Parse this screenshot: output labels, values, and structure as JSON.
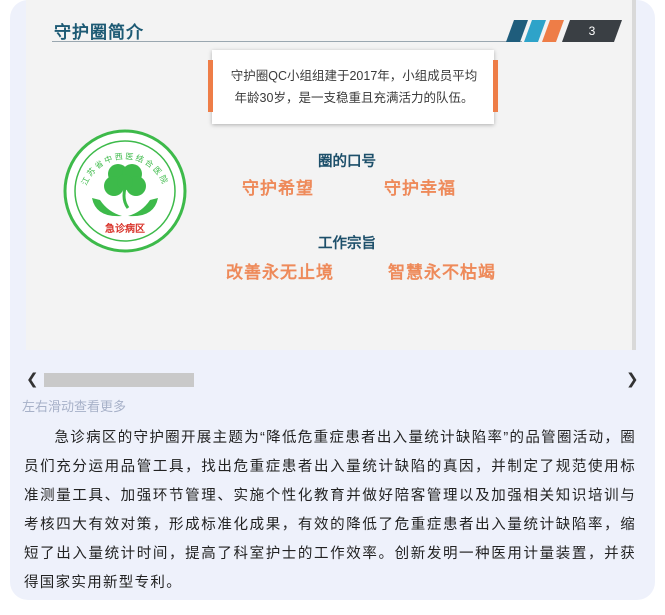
{
  "slide": {
    "title": "守护圈简介",
    "page_number": "3",
    "stripe_colors": [
      "#1f5d7c",
      "#2ea3c9",
      "#ee7d47"
    ],
    "intro": "守护圈QC小组组建于2017年，小组成员平均年龄30岁，是一支稳重且充满活力的队伍。",
    "slogan_heading": "圈的口号",
    "slogans": [
      "守护希望",
      "守护幸福"
    ],
    "purpose_heading": "工作宗旨",
    "purposes": [
      "改善永无止境",
      "智慧永不枯竭"
    ],
    "logo": {
      "ring_text": "江苏省中西医结合医院",
      "label": "急诊病区",
      "color": "#3dba4a"
    }
  },
  "scroll": {
    "left_icon": "chevron-left-icon",
    "right_icon": "chevron-right-icon"
  },
  "hint": "左右滑动查看更多",
  "paragraph": "急诊病区的守护圈开展主题为“降低危重症患者出入量统计缺陷率”的品管圈活动，圈员们充分运用品管工具，找出危重症患者出入量统计缺陷的真因，并制定了规范使用标准测量工具、加强环节管理、实施个性化教育并做好陪客管理以及加强相关知识培训与考核四大有效对策，形成标准化成果，有效的降低了危重症患者出入量统计缺陷率，缩短了出入量统计时间，提高了科室护士的工作效率。创新发明一种医用计量装置，并获得国家实用新型专利。"
}
